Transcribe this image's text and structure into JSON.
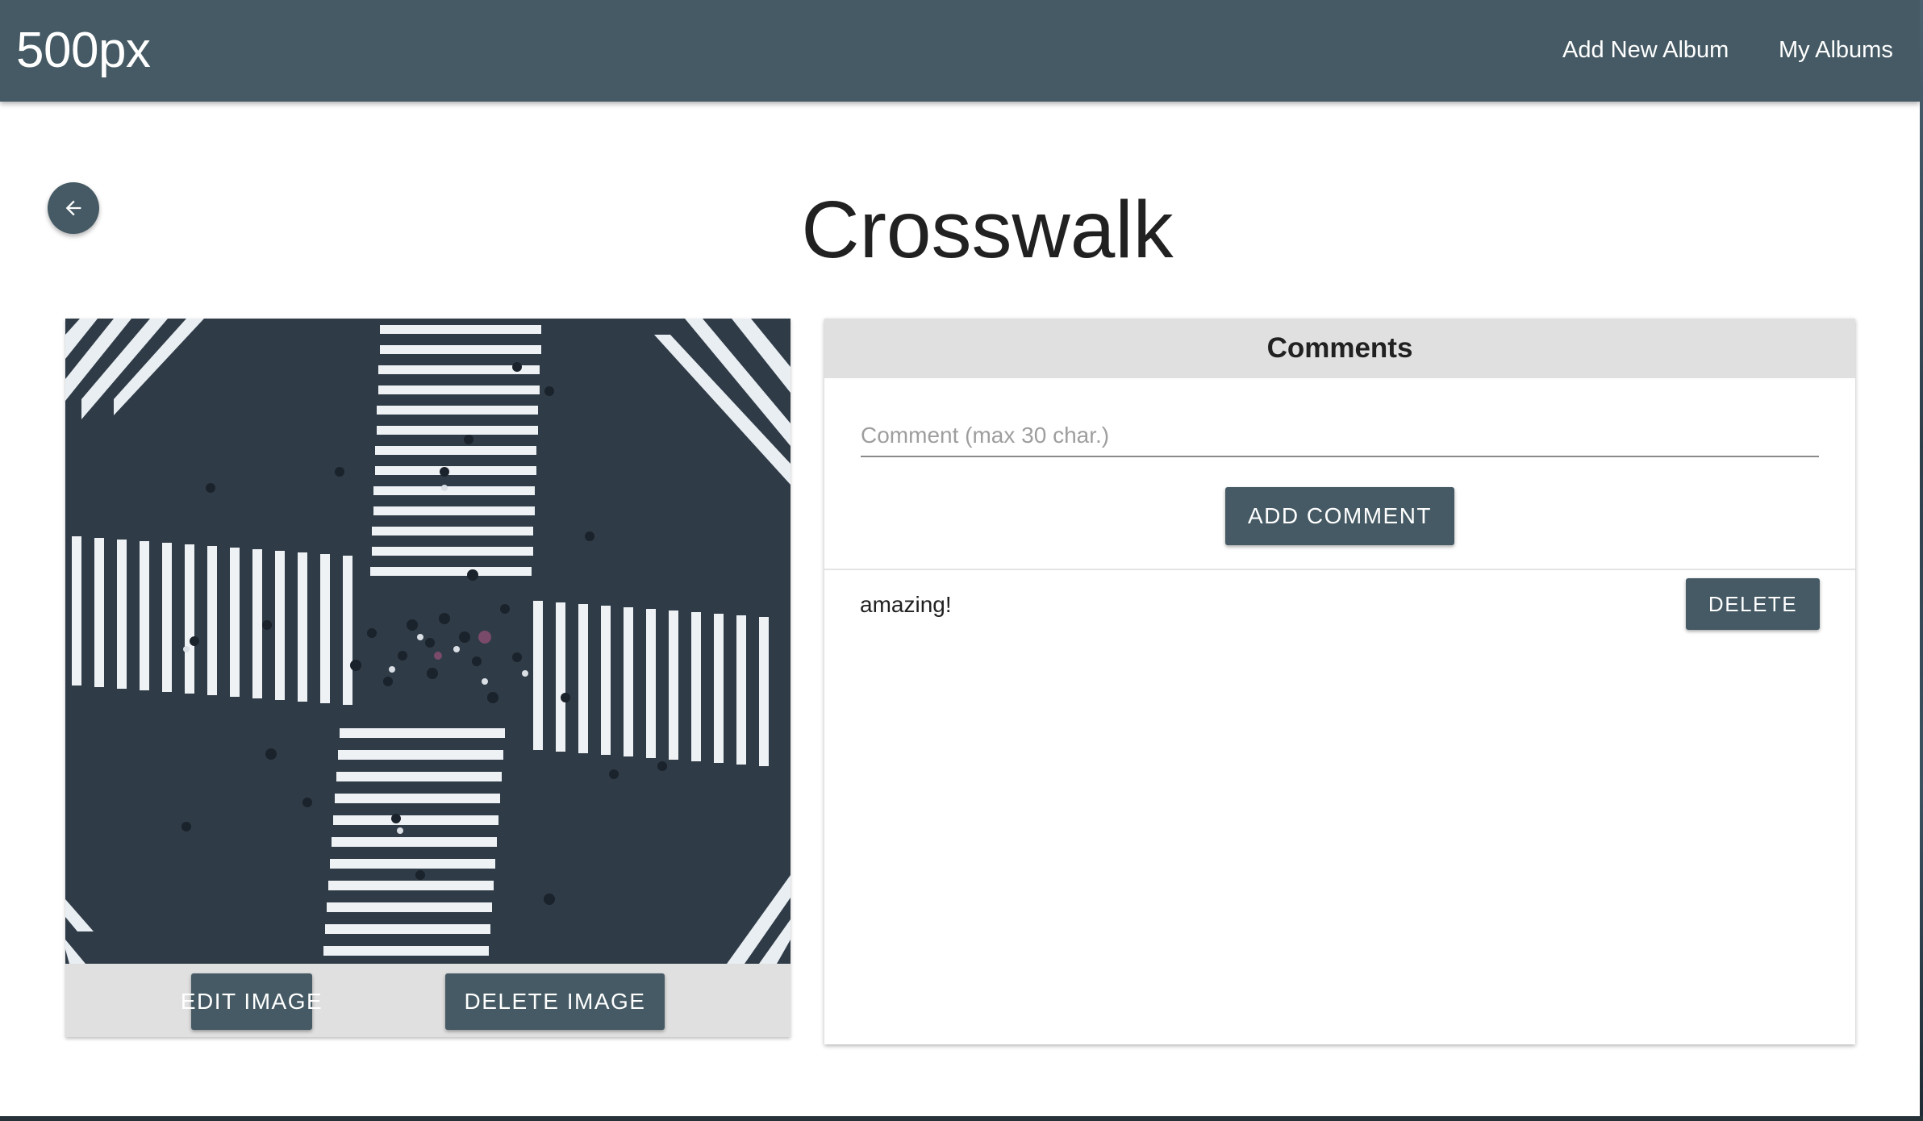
{
  "appbar": {
    "brand": "500px",
    "nav": {
      "add_album": "Add New Album",
      "my_albums": "My Albums"
    }
  },
  "colors": {
    "primary": "#455a64",
    "card_header": "#e0e0e0",
    "text": "#212121"
  },
  "icons": {
    "back": "arrow-left-icon"
  },
  "page": {
    "title": "Crosswalk"
  },
  "image_card": {
    "edit_label": "EDIT IMAGE",
    "delete_label": "DELETE IMAGE"
  },
  "comments": {
    "header": "Comments",
    "input_placeholder": "Comment (max 30 char.)",
    "input_value": "",
    "add_label": "ADD COMMENT",
    "items": [
      {
        "text": "amazing!",
        "delete_label": "DELETE"
      }
    ]
  }
}
